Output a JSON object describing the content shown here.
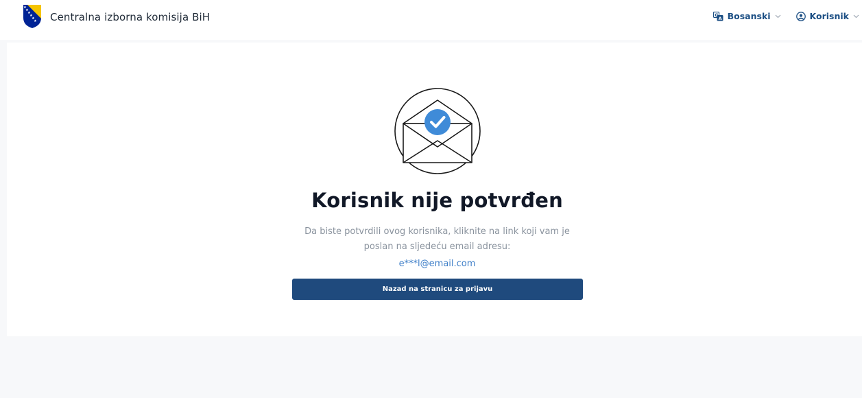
{
  "header": {
    "title": "Centralna izborna komisija BiH",
    "language_label": "Bosanski",
    "user_label": "Korisnik",
    "icons": [
      "bih-coat-of-arms-logo",
      "translate-icon",
      "chevron-down-icon",
      "user-circle-icon"
    ]
  },
  "main": {
    "heading": "Korisnik nije potvrđen",
    "description": "Da biste potvrdili ovog korisnika, kliknite na link koji vam je poslan na sljedeću email adresu:",
    "email": "e***l@email.com",
    "button_label": "Nazad na stranicu za prijavu",
    "illustration_icon": "envelope-check-icon"
  },
  "colors": {
    "accent": "#1f4a7d",
    "link": "#3f7fc8",
    "check_blue": "#3f8bd8",
    "flag_yellow": "#f5c400",
    "flag_blue": "#002395",
    "page_background": "#f7f8fa"
  }
}
